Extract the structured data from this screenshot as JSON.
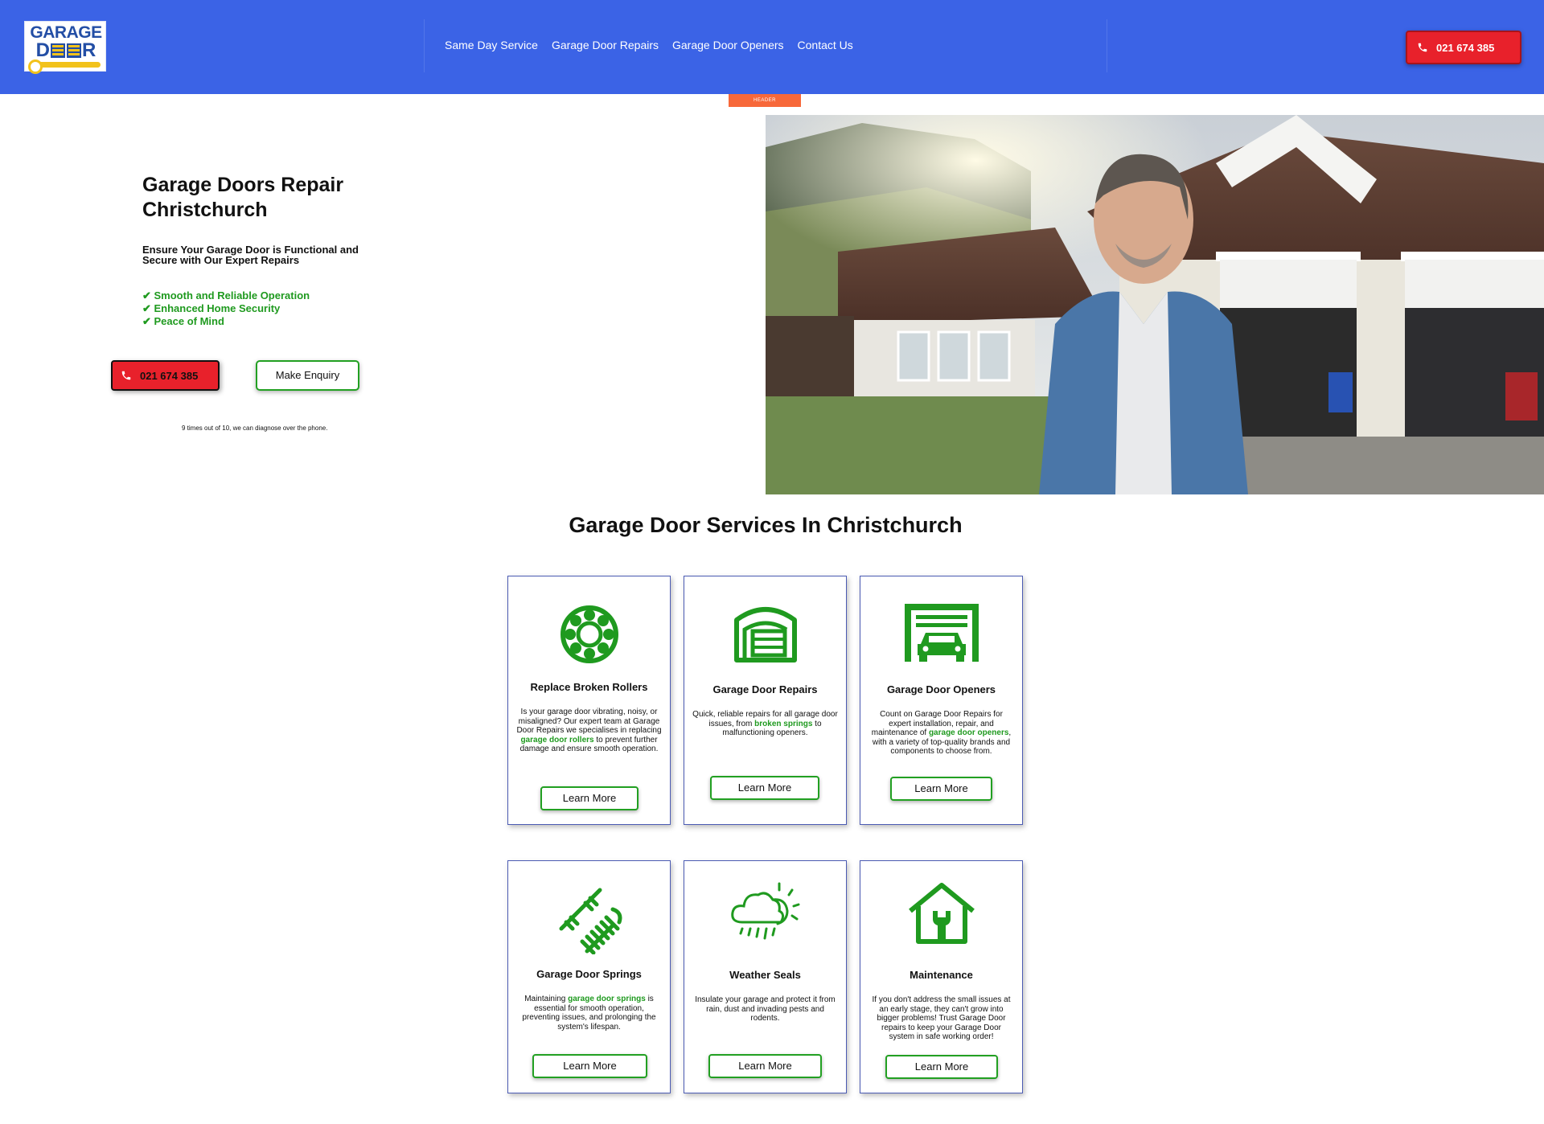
{
  "header": {
    "logo": {
      "line1": "GARAGE",
      "line2_left": "D",
      "line2_right": "R"
    },
    "nav": [
      "Same Day Service",
      "Garage Door Repairs",
      "Garage Door Openers",
      "Contact Us"
    ],
    "phone": "021 674 385",
    "tag": "HEADER"
  },
  "hero": {
    "title": "Garage Doors Repair Christchurch",
    "subtitle": "Ensure Your Garage Door is Functional and Secure with Our Expert Repairs",
    "checks": [
      "✔ Smooth and Reliable Operation",
      "✔ Enhanced Home Security",
      "✔ Peace of Mind"
    ],
    "phone": "021 674 385",
    "enquiry": "Make Enquiry",
    "note": "9 times out of 10, we can diagnose over the phone."
  },
  "services": {
    "heading": "Garage Door Services In Christchurch",
    "learn_more": "Learn More",
    "cards": [
      {
        "title": "Replace Broken Rollers",
        "desc_a": "Is your garage door vibrating, noisy, or misaligned? Our expert team at  Garage Door Repairs we specialises in replacing ",
        "link": "garage door rollers",
        "desc_b": " to prevent further damage and ensure smooth operation."
      },
      {
        "title": "Garage Door Repairs",
        "desc_a": "Quick, reliable repairs for all garage door issues, from ",
        "link": "broken springs",
        "desc_b": " to malfunctioning openers."
      },
      {
        "title": "Garage Door Openers",
        "desc_a": "Count on Garage Door Repairs for expert installation, repair, and maintenance of ",
        "link": "garage door openers",
        "desc_b": ", with a variety of top-quality brands and components to choose from."
      },
      {
        "title": "Garage Door Springs",
        "desc_a": "Maintaining ",
        "link": "garage door springs",
        "desc_b": " is essential for smooth operation, preventing issues, and prolonging the system's lifespan."
      },
      {
        "title": "Weather Seals",
        "desc_a": "Insulate your garage and protect it from rain, dust and invading pests and rodents.",
        "link": "",
        "desc_b": ""
      },
      {
        "title": "Maintenance",
        "desc_a": "If you don't address the small issues at an early stage, they can't grow into bigger problems! Trust Garage Door repairs to keep your Garage Door system in safe working order!",
        "link": "",
        "desc_b": ""
      }
    ]
  },
  "colors": {
    "header_bg": "#3b63e6",
    "call_red": "#e8212b",
    "accent_green": "#1f9a1f",
    "card_border": "#4b5bb3"
  }
}
